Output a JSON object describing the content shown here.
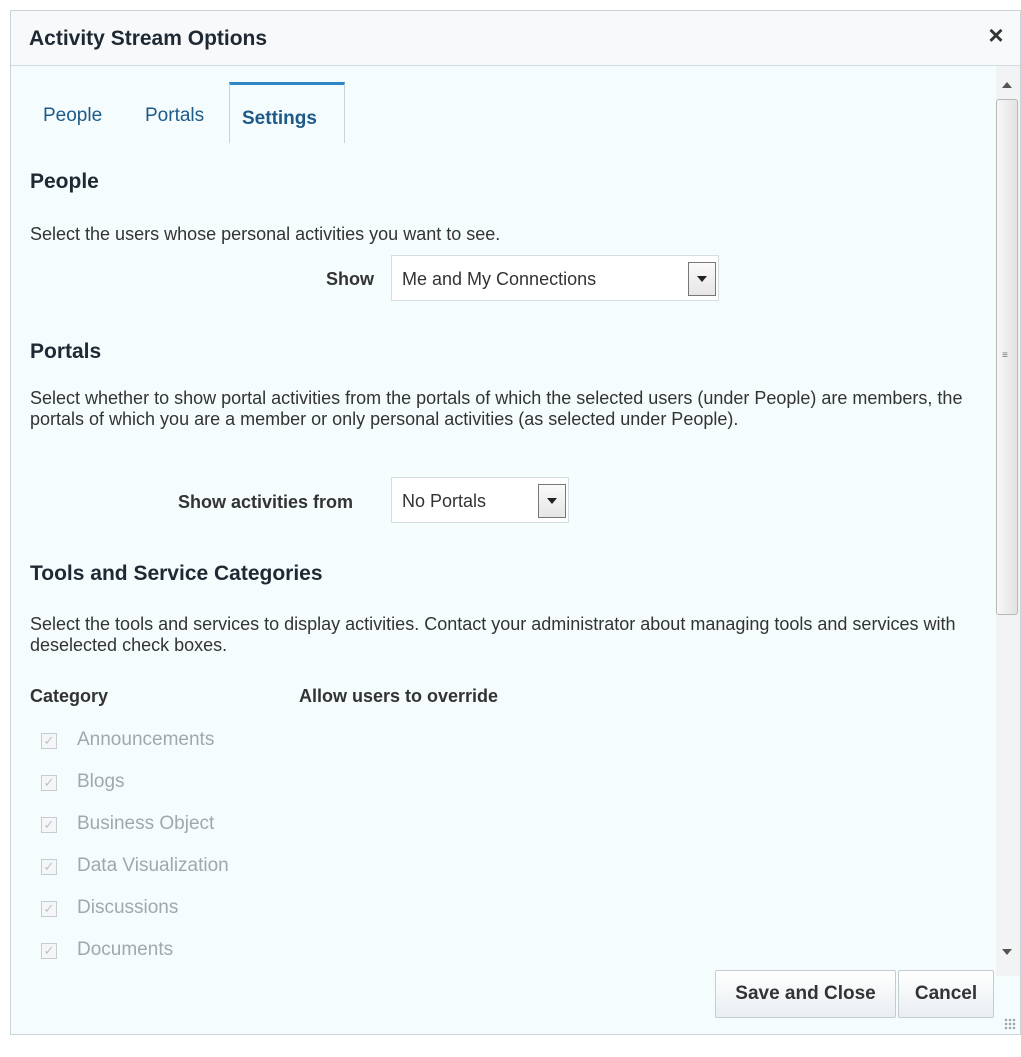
{
  "dialog": {
    "title": "Activity Stream Options",
    "close_label": "×"
  },
  "tabs": [
    {
      "label": "People",
      "selected": false
    },
    {
      "label": "Portals",
      "selected": false
    },
    {
      "label": "Settings",
      "selected": true
    }
  ],
  "people_section": {
    "heading": "People",
    "description": "Select the users whose personal activities you want to see.",
    "show_label": "Show",
    "show_value": "Me and My Connections"
  },
  "portals_section": {
    "heading": "Portals",
    "description": "Select whether to show portal activities from the portals of which the selected users (under People) are members, the portals of which you are a member or only personal activities (as selected under People).",
    "show_label": "Show activities from",
    "show_value": "No Portals"
  },
  "tools_section": {
    "heading": "Tools and Service Categories",
    "description": "Select the tools and services to display activities. Contact your administrator about managing tools and services with deselected check boxes.",
    "col_category": "Category",
    "col_override": "Allow users to override",
    "items": [
      {
        "label": "Announcements",
        "checked": true,
        "disabled": true
      },
      {
        "label": "Blogs",
        "checked": true,
        "disabled": true
      },
      {
        "label": "Business Object",
        "checked": true,
        "disabled": true
      },
      {
        "label": "Data Visualization",
        "checked": true,
        "disabled": true
      },
      {
        "label": "Discussions",
        "checked": true,
        "disabled": true
      },
      {
        "label": "Documents",
        "checked": true,
        "disabled": true
      }
    ]
  },
  "footer": {
    "save_label": "Save and Close",
    "cancel_label": "Cancel"
  },
  "icons": {
    "close": "close-icon",
    "dropdown": "chevron-down-icon",
    "check": "check-icon",
    "scroll_up": "scroll-up-arrow-icon",
    "scroll_down": "scroll-down-arrow-icon",
    "resize": "resize-grip-icon"
  }
}
